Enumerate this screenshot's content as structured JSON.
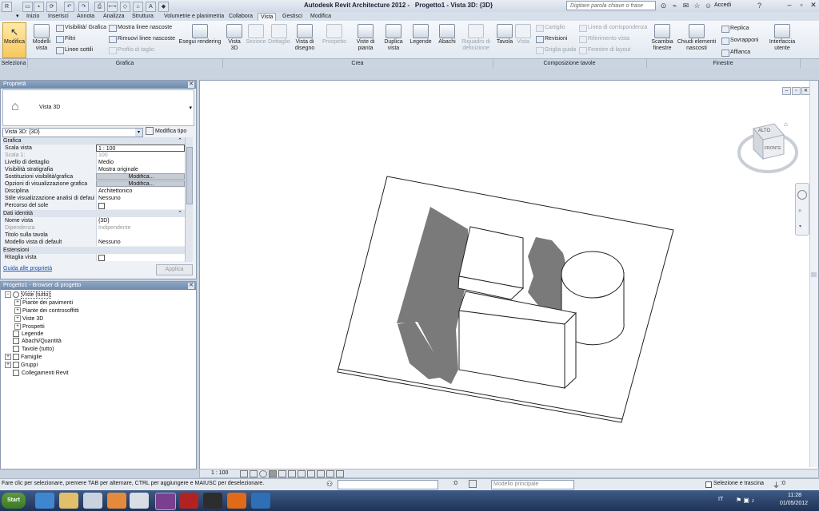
{
  "window": {
    "app_title": "Autodesk Revit Architecture 2012 -",
    "doc_title": "Progetto1 - Vista 3D: {3D}",
    "search_placeholder": "Digitare parola chiave o frase",
    "signin_label": "Accedi"
  },
  "tabs": [
    "Inizio",
    "Inserisci",
    "Annota",
    "Analizza",
    "Struttura",
    "Volumetrie e planimetria",
    "Collabora",
    "Vista",
    "Gestisci",
    "Modifica"
  ],
  "active_tab": "Vista",
  "ribbon": {
    "modifica": "Modifica",
    "modelli_vista": "Modelli vista",
    "visibilita_grafica": "Visibilità/ Grafica",
    "filtri": "Filtri",
    "linee_sottili": "Linee sottili",
    "mostra_linee_nascoste": "Mostra linee nascoste",
    "rimuovi_linee_nascoste": "Rimuovi linee nascoste",
    "profilo_di_taglio": "Profilo di taglio",
    "esegui_rendering": "Esegui rendering",
    "vista_3d": "Vista 3D",
    "sezione": "Sezione",
    "dettaglio": "Dettaglio",
    "vista_di_disegno": "Vista di disegno",
    "prospetto": "Prospetto",
    "viste_di_pianta": "Viste di pianta",
    "duplica_vista": "Duplica vista",
    "legende": "Legende",
    "abachi": "Abachi",
    "riquadro_di_definizione": "Riquadro di definizione",
    "tavola": "Tavola",
    "vista": "Vista",
    "cartiglio": "Cartiglio",
    "revisioni": "Revisioni",
    "griglia_guida": "Griglia guida",
    "linea_di_corrispondenza": "Linea di corrispondenza",
    "riferimento_vista": "Riferimento vista",
    "finestre_di_layout": "Finestre di layout",
    "scambia_finestre": "Scambia finestre",
    "chiudi_elementi_nascosti": "Chiudi elementi nascosti",
    "replica": "Replica",
    "sovrapponi": "Sovrapponi",
    "affianca": "Affianca",
    "interfaccia_utente": "Interfaccia utente",
    "panels": [
      "Seleziona",
      "Grafica",
      "Crea",
      "Composizione tavole",
      "Finestre"
    ]
  },
  "properties": {
    "header": "Proprietà",
    "type_name": "Vista 3D",
    "instance_selector": "Vista 3D: {3D}",
    "edit_type": "Modifica tipo",
    "sections": {
      "grafica": "Grafica",
      "dati_identita": "Dati identità",
      "estensioni": "Estensioni"
    },
    "grafica_rows": [
      {
        "k": "Scala vista",
        "v": "1 : 100"
      },
      {
        "k": "Scala 1:",
        "v": "100"
      },
      {
        "k": "Livello di dettaglio",
        "v": "Medio"
      },
      {
        "k": "Visibilità stratigrafia",
        "v": "Mostra originale"
      },
      {
        "k": "Sostituzioni visibilità/grafica",
        "v": "Modifica..."
      },
      {
        "k": "Opzioni di visualizzazione grafica",
        "v": "Modifica..."
      },
      {
        "k": "Disciplina",
        "v": "Architettonico"
      },
      {
        "k": "Stile visualizzazione analisi di default",
        "v": "Nessuno"
      },
      {
        "k": "Percorso del sole",
        "v": ""
      }
    ],
    "identita_rows": [
      {
        "k": "Nome vista",
        "v": "{3D}"
      },
      {
        "k": "Dipendenza",
        "v": "Indipendente"
      },
      {
        "k": "Titolo sulla tavola",
        "v": ""
      },
      {
        "k": "Modello vista di default",
        "v": "Nessuno"
      }
    ],
    "estensioni_rows": [
      {
        "k": "Ritaglia vista",
        "v": ""
      }
    ],
    "help_link": "Guida alle proprietà",
    "apply": "Applica"
  },
  "browser": {
    "header": "Progetto1 - Browser di progetto",
    "items": [
      {
        "label": "Viste (tutto)",
        "level": 0,
        "exp": "-"
      },
      {
        "label": "Piante dei pavimenti",
        "level": 1,
        "exp": "+"
      },
      {
        "label": "Piante dei controsoffitti",
        "level": 1,
        "exp": "+"
      },
      {
        "label": "Viste 3D",
        "level": 1,
        "exp": "+"
      },
      {
        "label": "Prospetti",
        "level": 1,
        "exp": "+"
      },
      {
        "label": "Legende",
        "level": 0,
        "exp": ""
      },
      {
        "label": "Abachi/Quantità",
        "level": 0,
        "exp": ""
      },
      {
        "label": "Tavole (tutto)",
        "level": 0,
        "exp": ""
      },
      {
        "label": "Famiglie",
        "level": 0,
        "exp": "+"
      },
      {
        "label": "Gruppi",
        "level": 0,
        "exp": "+"
      },
      {
        "label": "Collegamenti Revit",
        "level": 0,
        "exp": ""
      }
    ]
  },
  "viewcube": {
    "top": "ALTO",
    "front": "FRONTE"
  },
  "view_control": {
    "scale": "1 : 100"
  },
  "status": {
    "message": "Fare clic per selezionare, premere TAB per alternare, CTRL per aggiungere e MAIUSC per deselezionare.",
    "zero1": ":0",
    "model": "Modello principale",
    "select_drag": "Selezione e trascina",
    "filter_count": ":0"
  },
  "taskbar": {
    "start": "Start",
    "lang": "IT",
    "time": "11:28",
    "date": "01/05/2012"
  }
}
